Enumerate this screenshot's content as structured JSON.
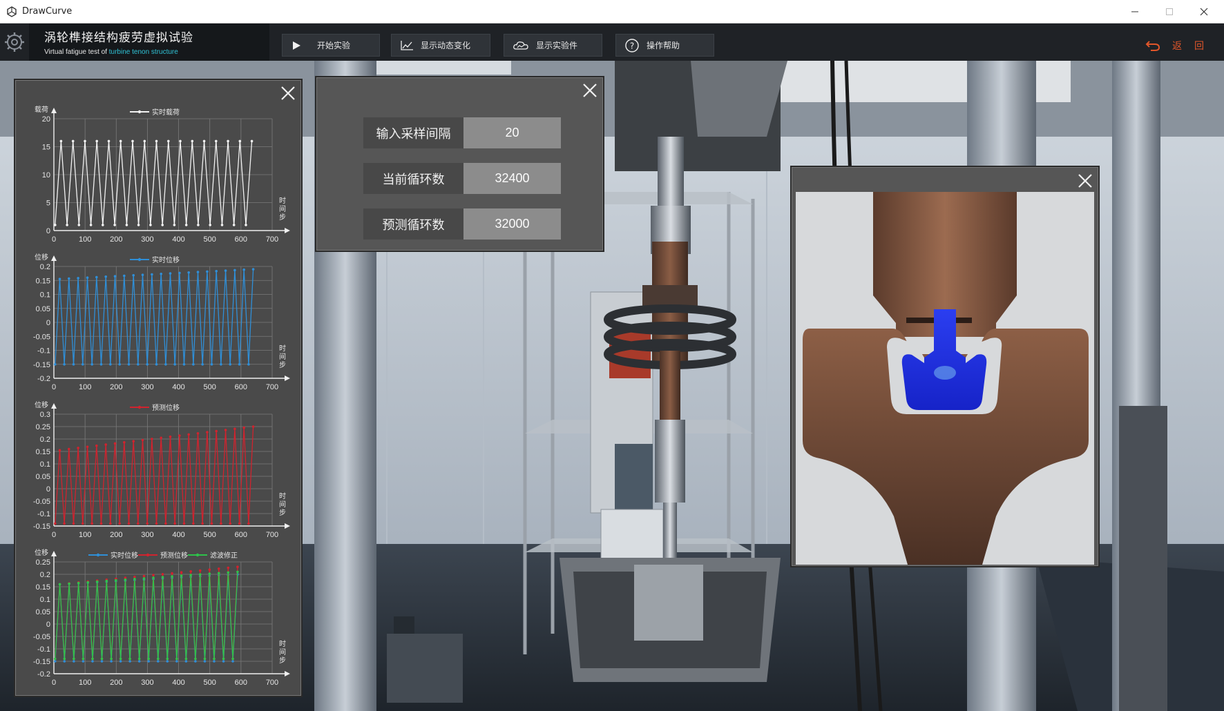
{
  "window": {
    "title": "DrawCurve"
  },
  "header": {
    "title_cn": "涡轮榫接结构疲劳虚拟试验",
    "title_en_prefix": "Virtual fatigue test of",
    "title_en_highlight": "turbine tenon structure"
  },
  "toolbar": {
    "buttons": [
      {
        "label": "开始实验",
        "icon": "play-icon"
      },
      {
        "label": "显示动态变化",
        "icon": "line-chart-icon"
      },
      {
        "label": "显示实验件",
        "icon": "cloud-icon"
      },
      {
        "label": "操作帮助",
        "icon": "help-icon"
      }
    ],
    "right": {
      "back_label": "返",
      "home_label": "回"
    }
  },
  "info": {
    "rows": [
      {
        "label": "输入采样间隔",
        "value": "20"
      },
      {
        "label": "当前循环数",
        "value": "32400"
      },
      {
        "label": "预测循环数",
        "value": "32000"
      }
    ]
  },
  "colors": {
    "white_series": "#f2f2f2",
    "blue_series": "#2f8fd8",
    "red_series": "#d0232e",
    "green_series": "#2ec24a",
    "panel": "#4a4a4a",
    "accent": "#e0562a"
  },
  "chart_data": [
    {
      "type": "line",
      "ylabel": "载荷",
      "xlabel": "时间步",
      "ylim": [
        0,
        20
      ],
      "yticks": [
        0,
        5,
        10,
        15,
        20
      ],
      "xlim": [
        0,
        700
      ],
      "xticks": [
        0,
        100,
        200,
        300,
        400,
        500,
        600,
        700
      ],
      "legend": [
        "实时载荷"
      ],
      "series": [
        {
          "name": "实时载荷",
          "color": "#f2f2f2",
          "x": [
            0,
            650
          ],
          "amplitude": [
            1,
            16
          ],
          "peaks": 17
        }
      ]
    },
    {
      "type": "line",
      "ylabel": "位移",
      "xlabel": "时间步",
      "ylim": [
        -0.2,
        0.2
      ],
      "yticks": [
        -0.2,
        -0.15,
        -0.1,
        -0.05,
        0,
        0.05,
        0.1,
        0.15,
        0.2
      ],
      "xlim": [
        0,
        700
      ],
      "xticks": [
        0,
        100,
        200,
        300,
        400,
        500,
        600,
        700
      ],
      "legend": [
        "实时位移"
      ],
      "series": [
        {
          "name": "实时位移",
          "color": "#2f8fd8",
          "x": [
            0,
            650
          ],
          "low": -0.15,
          "high": [
            0.155,
            0.19
          ],
          "peaks": 22
        }
      ]
    },
    {
      "type": "line",
      "ylabel": "位移",
      "xlabel": "时间步",
      "ylim": [
        -0.15,
        0.3
      ],
      "yticks": [
        -0.15,
        -0.1,
        -0.05,
        0,
        0.05,
        0.1,
        0.15,
        0.2,
        0.25,
        0.3
      ],
      "xlim": [
        0,
        700
      ],
      "xticks": [
        0,
        100,
        200,
        300,
        400,
        500,
        600,
        700
      ],
      "legend": [
        "预测位移"
      ],
      "series": [
        {
          "name": "预测位移",
          "color": "#d0232e",
          "x": [
            0,
            650
          ],
          "low": -0.14,
          "high": [
            0.155,
            0.25
          ],
          "peaks": 22
        }
      ]
    },
    {
      "type": "line",
      "ylabel": "位移",
      "xlabel": "时间步",
      "ylim": [
        -0.2,
        0.25
      ],
      "yticks": [
        -0.2,
        -0.15,
        -0.1,
        -0.05,
        0,
        0.05,
        0.1,
        0.15,
        0.2,
        0.25
      ],
      "xlim": [
        0,
        700
      ],
      "xticks": [
        0,
        100,
        200,
        300,
        400,
        500,
        600,
        700
      ],
      "legend": [
        "实时位移",
        "预测位移",
        "滤波修正"
      ],
      "series": [
        {
          "name": "实时位移",
          "color": "#2f8fd8",
          "x": [
            0,
            600
          ],
          "low": -0.15,
          "high": [
            0.16,
            0.2
          ],
          "peaks": 20
        },
        {
          "name": "预测位移",
          "color": "#d0232e",
          "x": [
            0,
            600
          ],
          "low": -0.14,
          "high": [
            0.16,
            0.23
          ],
          "peaks": 20
        },
        {
          "name": "滤波修正",
          "color": "#2ec24a",
          "x": [
            0,
            600
          ],
          "low": -0.14,
          "high": [
            0.16,
            0.21
          ],
          "peaks": 20
        }
      ]
    }
  ]
}
